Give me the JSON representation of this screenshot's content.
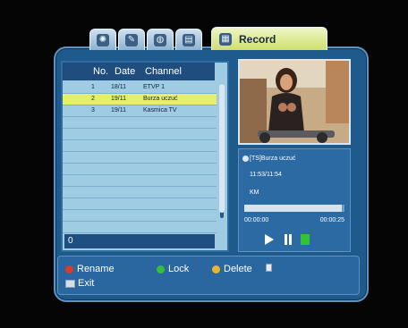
{
  "tabs": [
    {
      "icon": "satellite-icon"
    },
    {
      "icon": "tools-icon"
    },
    {
      "icon": "globe-icon"
    },
    {
      "icon": "film-icon"
    },
    {
      "icon": "record-icon",
      "label": "Record",
      "active": true
    }
  ],
  "list": {
    "headers": {
      "no": "No.",
      "date": "Date",
      "channel": "Channel"
    },
    "rows": [
      {
        "no": "1",
        "date": "18/11",
        "channel": "ETVP 1"
      },
      {
        "no": "2",
        "date": "19/11",
        "channel": "Burza uczuć",
        "selected": true
      },
      {
        "no": "3",
        "date": "19/11",
        "channel": "Kasmica TV"
      }
    ],
    "empty_rows": 10,
    "footer_value": "0"
  },
  "info": {
    "title": "[TS]Burza uczuć",
    "time": "11:53/11:54",
    "size": "KM",
    "progress_fraction": 0.97,
    "time_start": "00:00:00",
    "time_end": "00:00:25",
    "controls": [
      "play-icon",
      "pause-icon",
      "stop-icon"
    ]
  },
  "keys": {
    "rename": "Rename",
    "lock": "Lock",
    "delete": "Delete",
    "exit": "Exit"
  },
  "colors": {
    "red": "#d83a2c",
    "green": "#34c23a",
    "yellow": "#e8b52b",
    "accent": "#e3f06a"
  }
}
